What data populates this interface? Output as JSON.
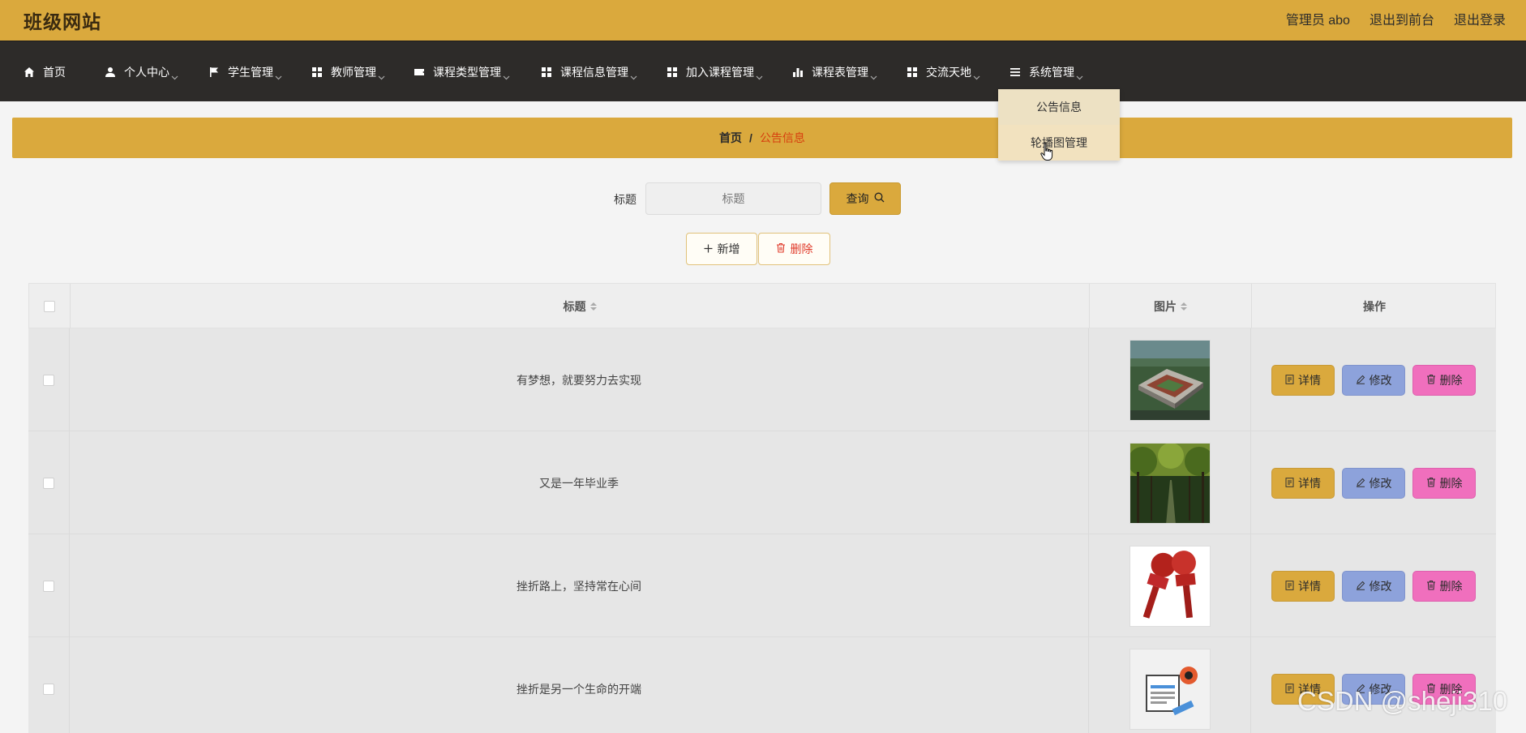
{
  "header": {
    "site_title": "班级网站",
    "admin_label": "管理员 abo",
    "back_front": "退出到前台",
    "logout": "退出登录"
  },
  "nav": {
    "items": [
      {
        "label": "首页",
        "icon": "home-icon"
      },
      {
        "label": "个人中心",
        "icon": "user-icon"
      },
      {
        "label": "学生管理",
        "icon": "flag-icon"
      },
      {
        "label": "教师管理",
        "icon": "grid-icon"
      },
      {
        "label": "课程类型管理",
        "icon": "ticket-icon"
      },
      {
        "label": "课程信息管理",
        "icon": "grid-icon"
      },
      {
        "label": "加入课程管理",
        "icon": "grid-icon"
      },
      {
        "label": "课程表管理",
        "icon": "bar-chart-icon"
      },
      {
        "label": "交流天地",
        "icon": "grid-icon"
      },
      {
        "label": "系统管理",
        "icon": "list-icon"
      }
    ]
  },
  "dropdown": {
    "items": [
      "公告信息",
      "轮播图管理"
    ]
  },
  "breadcrumb": {
    "home": "首页",
    "separator": "/",
    "current": "公告信息"
  },
  "search": {
    "label": "标题",
    "placeholder": "标题",
    "button": "查询"
  },
  "actions": {
    "add": "新增",
    "delete": "删除"
  },
  "table": {
    "headers": {
      "title": "标题",
      "image": "图片",
      "ops": "操作"
    },
    "row_buttons": {
      "detail": "详情",
      "edit": "修改",
      "delete": "删除"
    },
    "rows": [
      {
        "title": "有梦想，就要努力去实现",
        "image": "campus-building-photo"
      },
      {
        "title": "又是一年毕业季",
        "image": "tree-avenue-photo"
      },
      {
        "title": "挫折路上，坚持常在心间",
        "image": "news-microphones-image"
      },
      {
        "title": "挫折是另一个生命的开端",
        "image": "newspaper-icon-image"
      }
    ]
  },
  "watermark": "CSDN @sheji310",
  "colors": {
    "accent": "#daa93d",
    "nav_bg": "#2d2b29",
    "detail_btn": "#daa93d",
    "edit_btn": "#8da2db",
    "delete_btn": "#f06fbd",
    "breadcrumb_current": "#d7400f"
  }
}
